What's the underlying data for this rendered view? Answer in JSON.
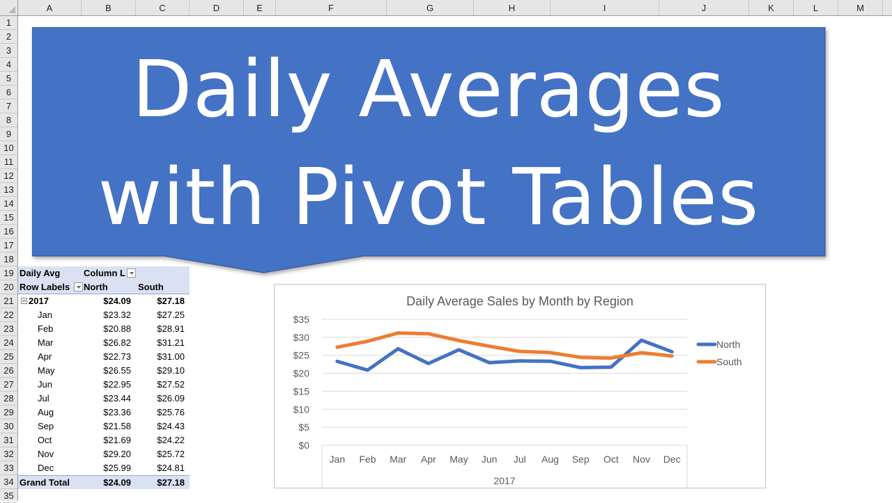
{
  "spreadsheet": {
    "columns": [
      "A",
      "B",
      "C",
      "D",
      "E",
      "F",
      "G",
      "H",
      "I",
      "J",
      "K",
      "L",
      "M"
    ],
    "rows": [
      "1",
      "2",
      "3",
      "4",
      "5",
      "6",
      "7",
      "8",
      "9",
      "10",
      "11",
      "12",
      "13",
      "14",
      "15",
      "16",
      "17",
      "18",
      "19",
      "20",
      "21",
      "22",
      "23",
      "24",
      "25",
      "26",
      "27",
      "28",
      "29",
      "30",
      "31",
      "32",
      "33",
      "34",
      "35"
    ]
  },
  "banner": {
    "line1": "Daily Averages",
    "line2": "with Pivot Tables",
    "color": "#4472c4"
  },
  "pivot": {
    "value_label": "Daily Avg",
    "column_labels": "Column L",
    "row_labels": "Row Labels",
    "col_north": "North",
    "col_south": "South",
    "year": "2017",
    "year_north": "$24.09",
    "year_south": "$27.18",
    "months": [
      {
        "m": "Jan",
        "n": "$23.32",
        "s": "$27.25"
      },
      {
        "m": "Feb",
        "n": "$20.88",
        "s": "$28.91"
      },
      {
        "m": "Mar",
        "n": "$26.82",
        "s": "$31.21"
      },
      {
        "m": "Apr",
        "n": "$22.73",
        "s": "$31.00"
      },
      {
        "m": "May",
        "n": "$26.55",
        "s": "$29.10"
      },
      {
        "m": "Jun",
        "n": "$22.95",
        "s": "$27.52"
      },
      {
        "m": "Jul",
        "n": "$23.44",
        "s": "$26.09"
      },
      {
        "m": "Aug",
        "n": "$23.36",
        "s": "$25.76"
      },
      {
        "m": "Sep",
        "n": "$21.58",
        "s": "$24.43"
      },
      {
        "m": "Oct",
        "n": "$21.69",
        "s": "$24.22"
      },
      {
        "m": "Nov",
        "n": "$29.20",
        "s": "$25.72"
      },
      {
        "m": "Dec",
        "n": "$25.99",
        "s": "$24.81"
      }
    ],
    "grand_total_label": "Grand Total",
    "grand_north": "$24.09",
    "grand_south": "$27.18"
  },
  "chart_data": {
    "type": "line",
    "title": "Daily Average Sales by Month by Region",
    "categories": [
      "Jan",
      "Feb",
      "Mar",
      "Apr",
      "May",
      "Jun",
      "Jul",
      "Aug",
      "Sep",
      "Oct",
      "Nov",
      "Dec"
    ],
    "category_group": "2017",
    "series": [
      {
        "name": "North",
        "color": "#4472c4",
        "values": [
          23.32,
          20.88,
          26.82,
          22.73,
          26.55,
          22.95,
          23.44,
          23.36,
          21.58,
          21.69,
          29.2,
          25.99
        ]
      },
      {
        "name": "South",
        "color": "#ed7d31",
        "values": [
          27.25,
          28.91,
          31.21,
          31.0,
          29.1,
          27.52,
          26.09,
          25.76,
          24.43,
          24.22,
          25.72,
          24.81
        ]
      }
    ],
    "yticks": [
      "$0",
      "$5",
      "$10",
      "$15",
      "$20",
      "$25",
      "$30",
      "$35"
    ],
    "ylim": [
      0,
      35
    ],
    "grid": true,
    "legend": "right",
    "xlabel": "",
    "ylabel": ""
  }
}
